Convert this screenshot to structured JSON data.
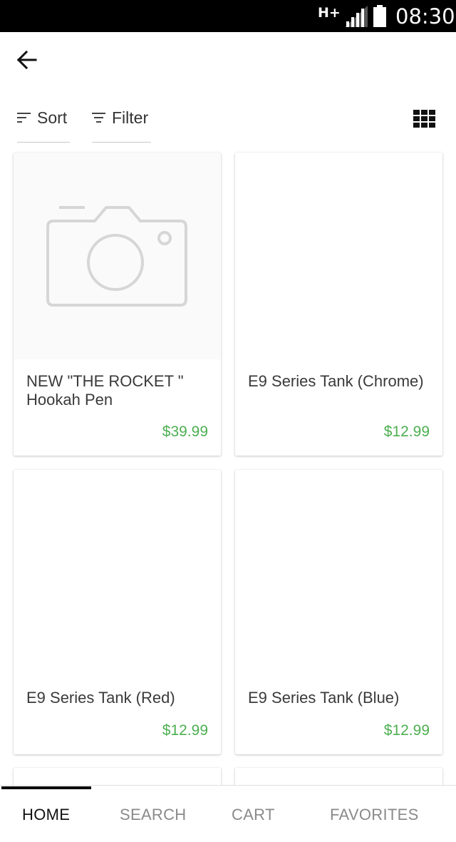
{
  "status_bar": {
    "network": "H+",
    "time": "08:30"
  },
  "toolbar": {
    "sort_label": "Sort",
    "filter_label": "Filter"
  },
  "products": [
    {
      "title": "NEW \"THE ROCKET \" Hookah Pen",
      "price": "$39.99",
      "image": "camera-placeholder"
    },
    {
      "title": "E9 Series Tank (Chrome)",
      "price": "$12.99",
      "image": "blank"
    },
    {
      "title": "E9 Series Tank (Red)",
      "price": "$12.99",
      "image": "blank"
    },
    {
      "title": "E9 Series Tank (Blue)",
      "price": "$12.99",
      "image": "blank"
    }
  ],
  "bottom_nav": {
    "items": [
      "HOME",
      "SEARCH",
      "CART",
      "FAVORITES"
    ],
    "active": "HOME"
  },
  "colors": {
    "price": "#4caf50",
    "status_bar": "#000000",
    "active_indicator": "#000000"
  }
}
